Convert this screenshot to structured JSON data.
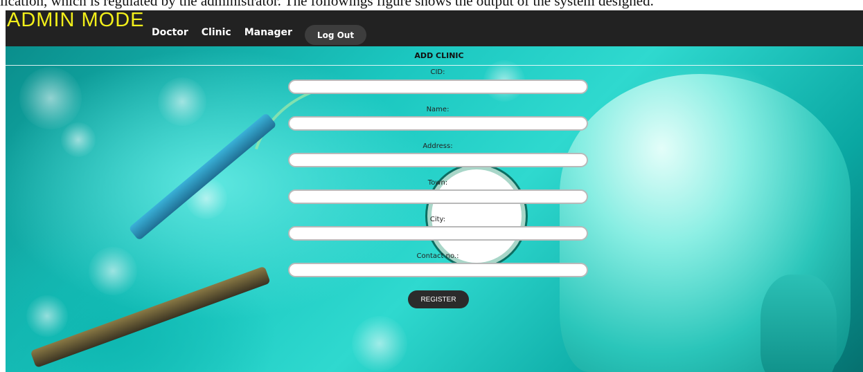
{
  "caption": "lication, which is regulated by the administrator. The followings figure shows the output of the system designed.",
  "header": {
    "brand": "ADMIN MODE",
    "nav": [
      "Doctor",
      "Clinic",
      "Manager"
    ],
    "logout_label": "Log Out"
  },
  "form": {
    "title": "ADD CLINIC",
    "fields": [
      {
        "label": "CID:",
        "value": ""
      },
      {
        "label": "Name:",
        "value": ""
      },
      {
        "label": "Address:",
        "value": ""
      },
      {
        "label": "Town:",
        "value": ""
      },
      {
        "label": "City:",
        "value": ""
      },
      {
        "label": "Contact no.:",
        "value": ""
      }
    ],
    "submit_label": "REGISTER"
  },
  "colors": {
    "brand": "#f2ef1a",
    "topbar": "#222222",
    "button": "#2b2b2b",
    "background_teal": "#1bc7c0"
  }
}
